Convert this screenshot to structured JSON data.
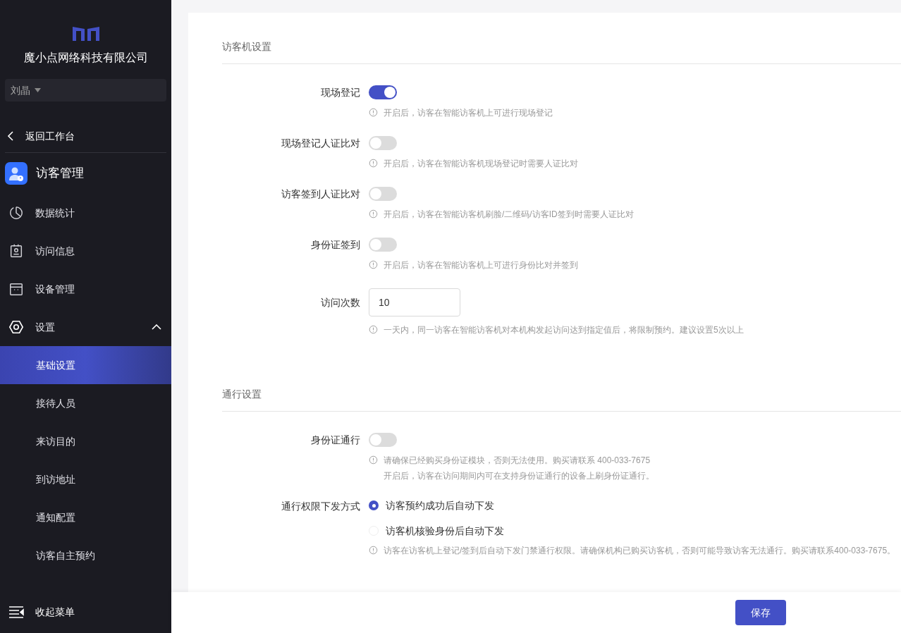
{
  "sidebar": {
    "company": "魔小点网络科技有限公司",
    "user": "刘晶",
    "back": "返回工作台",
    "app_title": "访客管理",
    "menu": [
      {
        "label": "数据统计"
      },
      {
        "label": "访问信息"
      },
      {
        "label": "设备管理"
      },
      {
        "label": "设置",
        "expanded": true,
        "children": [
          {
            "label": "基础设置",
            "selected": true
          },
          {
            "label": "接待人员",
            "selected": false
          },
          {
            "label": "来访目的",
            "selected": false
          },
          {
            "label": "到访地址",
            "selected": false
          },
          {
            "label": "通知配置",
            "selected": false
          },
          {
            "label": "访客自主预约",
            "selected": false
          }
        ]
      }
    ],
    "collapse": "收起菜单"
  },
  "sections": [
    {
      "title": "访客机设置",
      "fields": [
        {
          "kind": "toggle",
          "label": "现场登记",
          "on": true,
          "hints": [
            "开启后，访客在智能访客机上可进行现场登记"
          ]
        },
        {
          "kind": "toggle",
          "label": "现场登记人证比对",
          "on": false,
          "hints": [
            "开启后，访客在智能访客机现场登记时需要人证比对"
          ]
        },
        {
          "kind": "toggle",
          "label": "访客签到人证比对",
          "on": false,
          "hints": [
            "开启后，访客在智能访客机刷脸/二维码/访客ID签到时需要人证比对"
          ]
        },
        {
          "kind": "toggle",
          "label": "身份证签到",
          "on": false,
          "hints": [
            "开启后，访客在智能访客机上可进行身份比对并签到"
          ]
        },
        {
          "kind": "input",
          "label": "访问次数",
          "value": "10",
          "hints": [
            "一天内，同一访客在智能访客机对本机构发起访问达到指定值后，将限制预约。建议设置5次以上"
          ]
        }
      ]
    },
    {
      "title": "通行设置",
      "fields": [
        {
          "kind": "toggle",
          "label": "身份证通行",
          "on": false,
          "hints": [
            "请确保已经购买身份证模块，否则无法使用。购买请联系 400-033-7675",
            "开启后，访客在访问期间内可在支持身份证通行的设备上刷身份证通行。"
          ]
        },
        {
          "kind": "radio",
          "label": "通行权限下发方式",
          "options": [
            {
              "label": "访客预约成功后自动下发",
              "selected": true
            },
            {
              "label": "访客机核验身份后自动下发",
              "selected": false
            }
          ],
          "hints": [
            "访客在访客机上登记/签到后自动下发门禁通行权限。请确保机构已购买访客机，否则可能导致访客无法通行。购买请联系400-033-7675。"
          ]
        }
      ]
    }
  ],
  "save": "保存"
}
